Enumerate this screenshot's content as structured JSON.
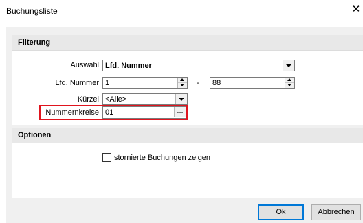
{
  "window": {
    "title": "Buchungsliste",
    "close_glyph": "✕"
  },
  "sections": {
    "filter": {
      "heading": "Filterung"
    },
    "options": {
      "heading": "Optionen"
    }
  },
  "filter": {
    "auswahl": {
      "label": "Auswahl",
      "value": "Lfd. Nummer"
    },
    "lfd_nummer": {
      "label": "Lfd. Nummer",
      "from": "1",
      "separator": "-",
      "to": "88"
    },
    "kuerzel": {
      "label": "Kürzel",
      "value": "<Alle>"
    },
    "nummernkreise": {
      "label": "Nummernkreise",
      "value": "01",
      "button": "..."
    }
  },
  "options": {
    "show_cancelled": {
      "label": "stornierte Buchungen zeigen",
      "checked": false
    }
  },
  "buttons": {
    "ok": "Ok",
    "cancel": "Abbrechen"
  },
  "colors": {
    "highlight": "#e0141e",
    "default_button_border": "#0078d7"
  },
  "icons": {
    "close": "close-icon",
    "dropdown": "chevron-down-icon",
    "spin": "spin-arrows-icon"
  }
}
